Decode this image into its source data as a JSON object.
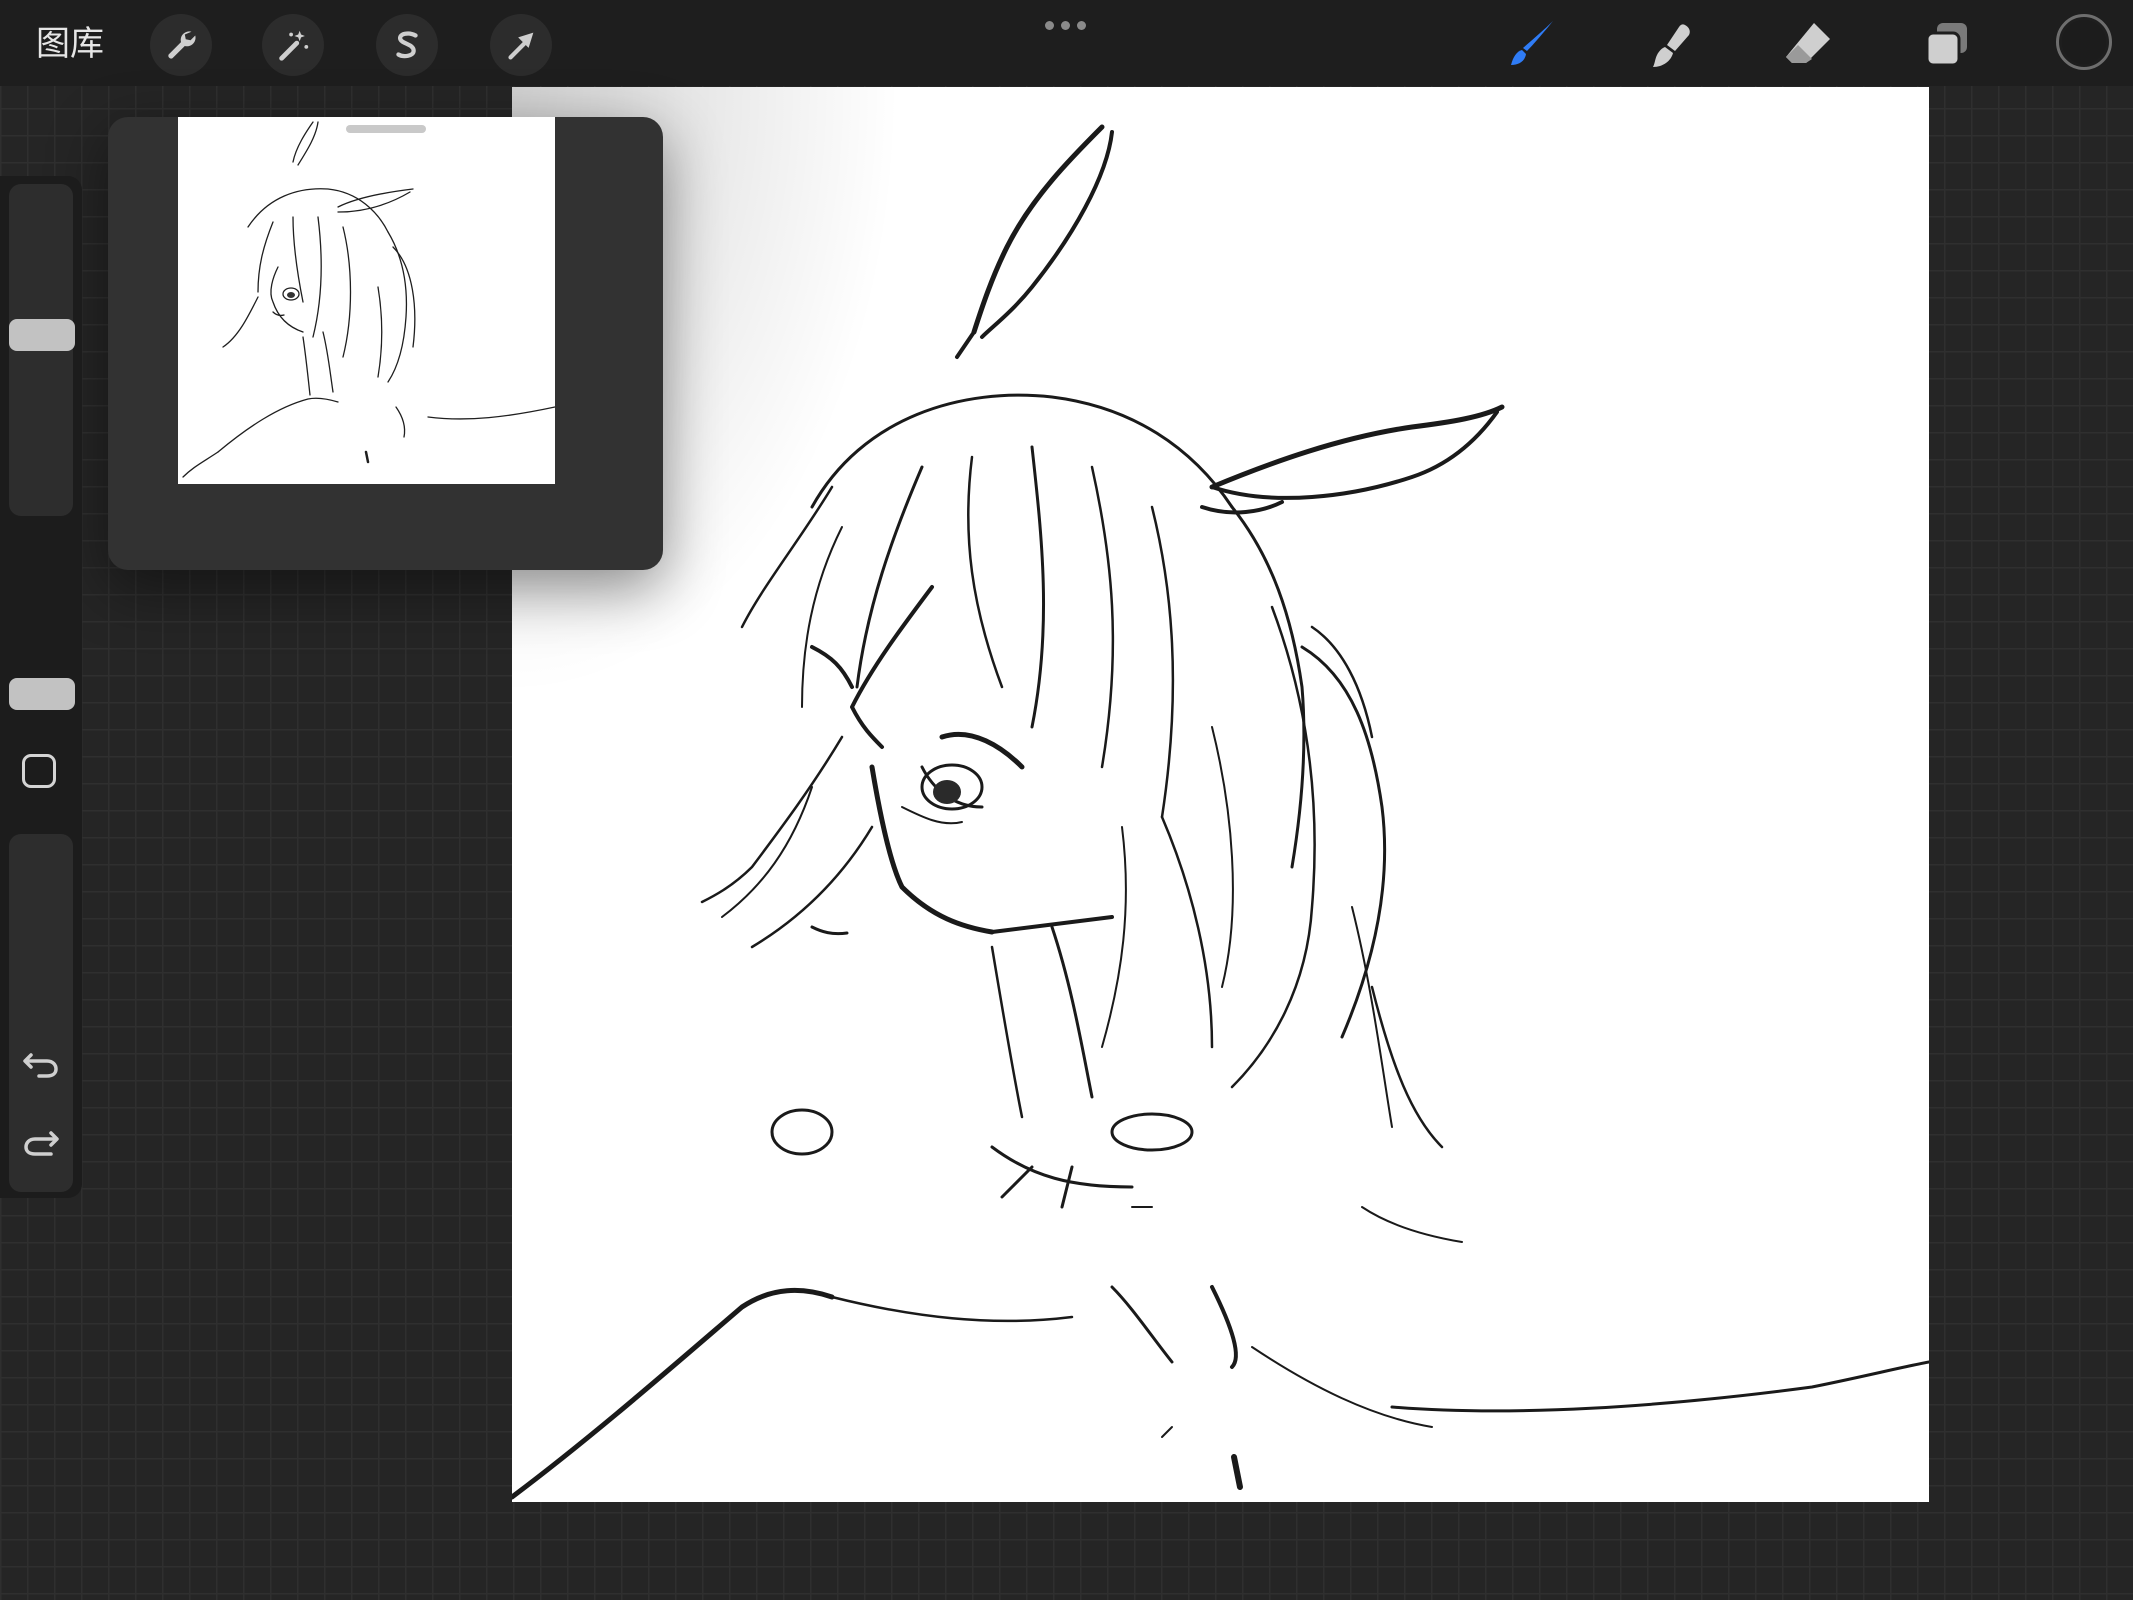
{
  "toolbar": {
    "gallery_label": "图库",
    "left_tools": [
      {
        "name": "actions",
        "icon": "wrench-icon"
      },
      {
        "name": "adjustments",
        "icon": "magic-wand-icon"
      },
      {
        "name": "selection",
        "icon": "selection-s-icon"
      },
      {
        "name": "transform",
        "icon": "arrow-cursor-icon"
      }
    ],
    "more_icon": "ellipsis-icon",
    "right_tools": [
      {
        "name": "brush",
        "icon": "brush-icon",
        "active": true
      },
      {
        "name": "smudge",
        "icon": "smudge-icon",
        "active": false
      },
      {
        "name": "eraser",
        "icon": "eraser-icon",
        "active": false
      },
      {
        "name": "layers",
        "icon": "layers-icon",
        "active": false
      }
    ],
    "active_color": "#1c1c1c",
    "accent_color": "#2f7cf6"
  },
  "sidebar": {
    "brush_size_slider": {
      "level": 0.45
    },
    "opacity_slider": {
      "level": 0.62
    },
    "modify_icon": "square-outline-icon",
    "undo_icon": "undo-icon",
    "redo_icon": "redo-icon"
  },
  "reference_panel": {
    "title": "",
    "handle_icon": "drag-handle-icon",
    "image": "sketch-thumbnail"
  },
  "canvas": {
    "background": "#ffffff",
    "artwork": "sketch-girl-with-feather-ears"
  }
}
